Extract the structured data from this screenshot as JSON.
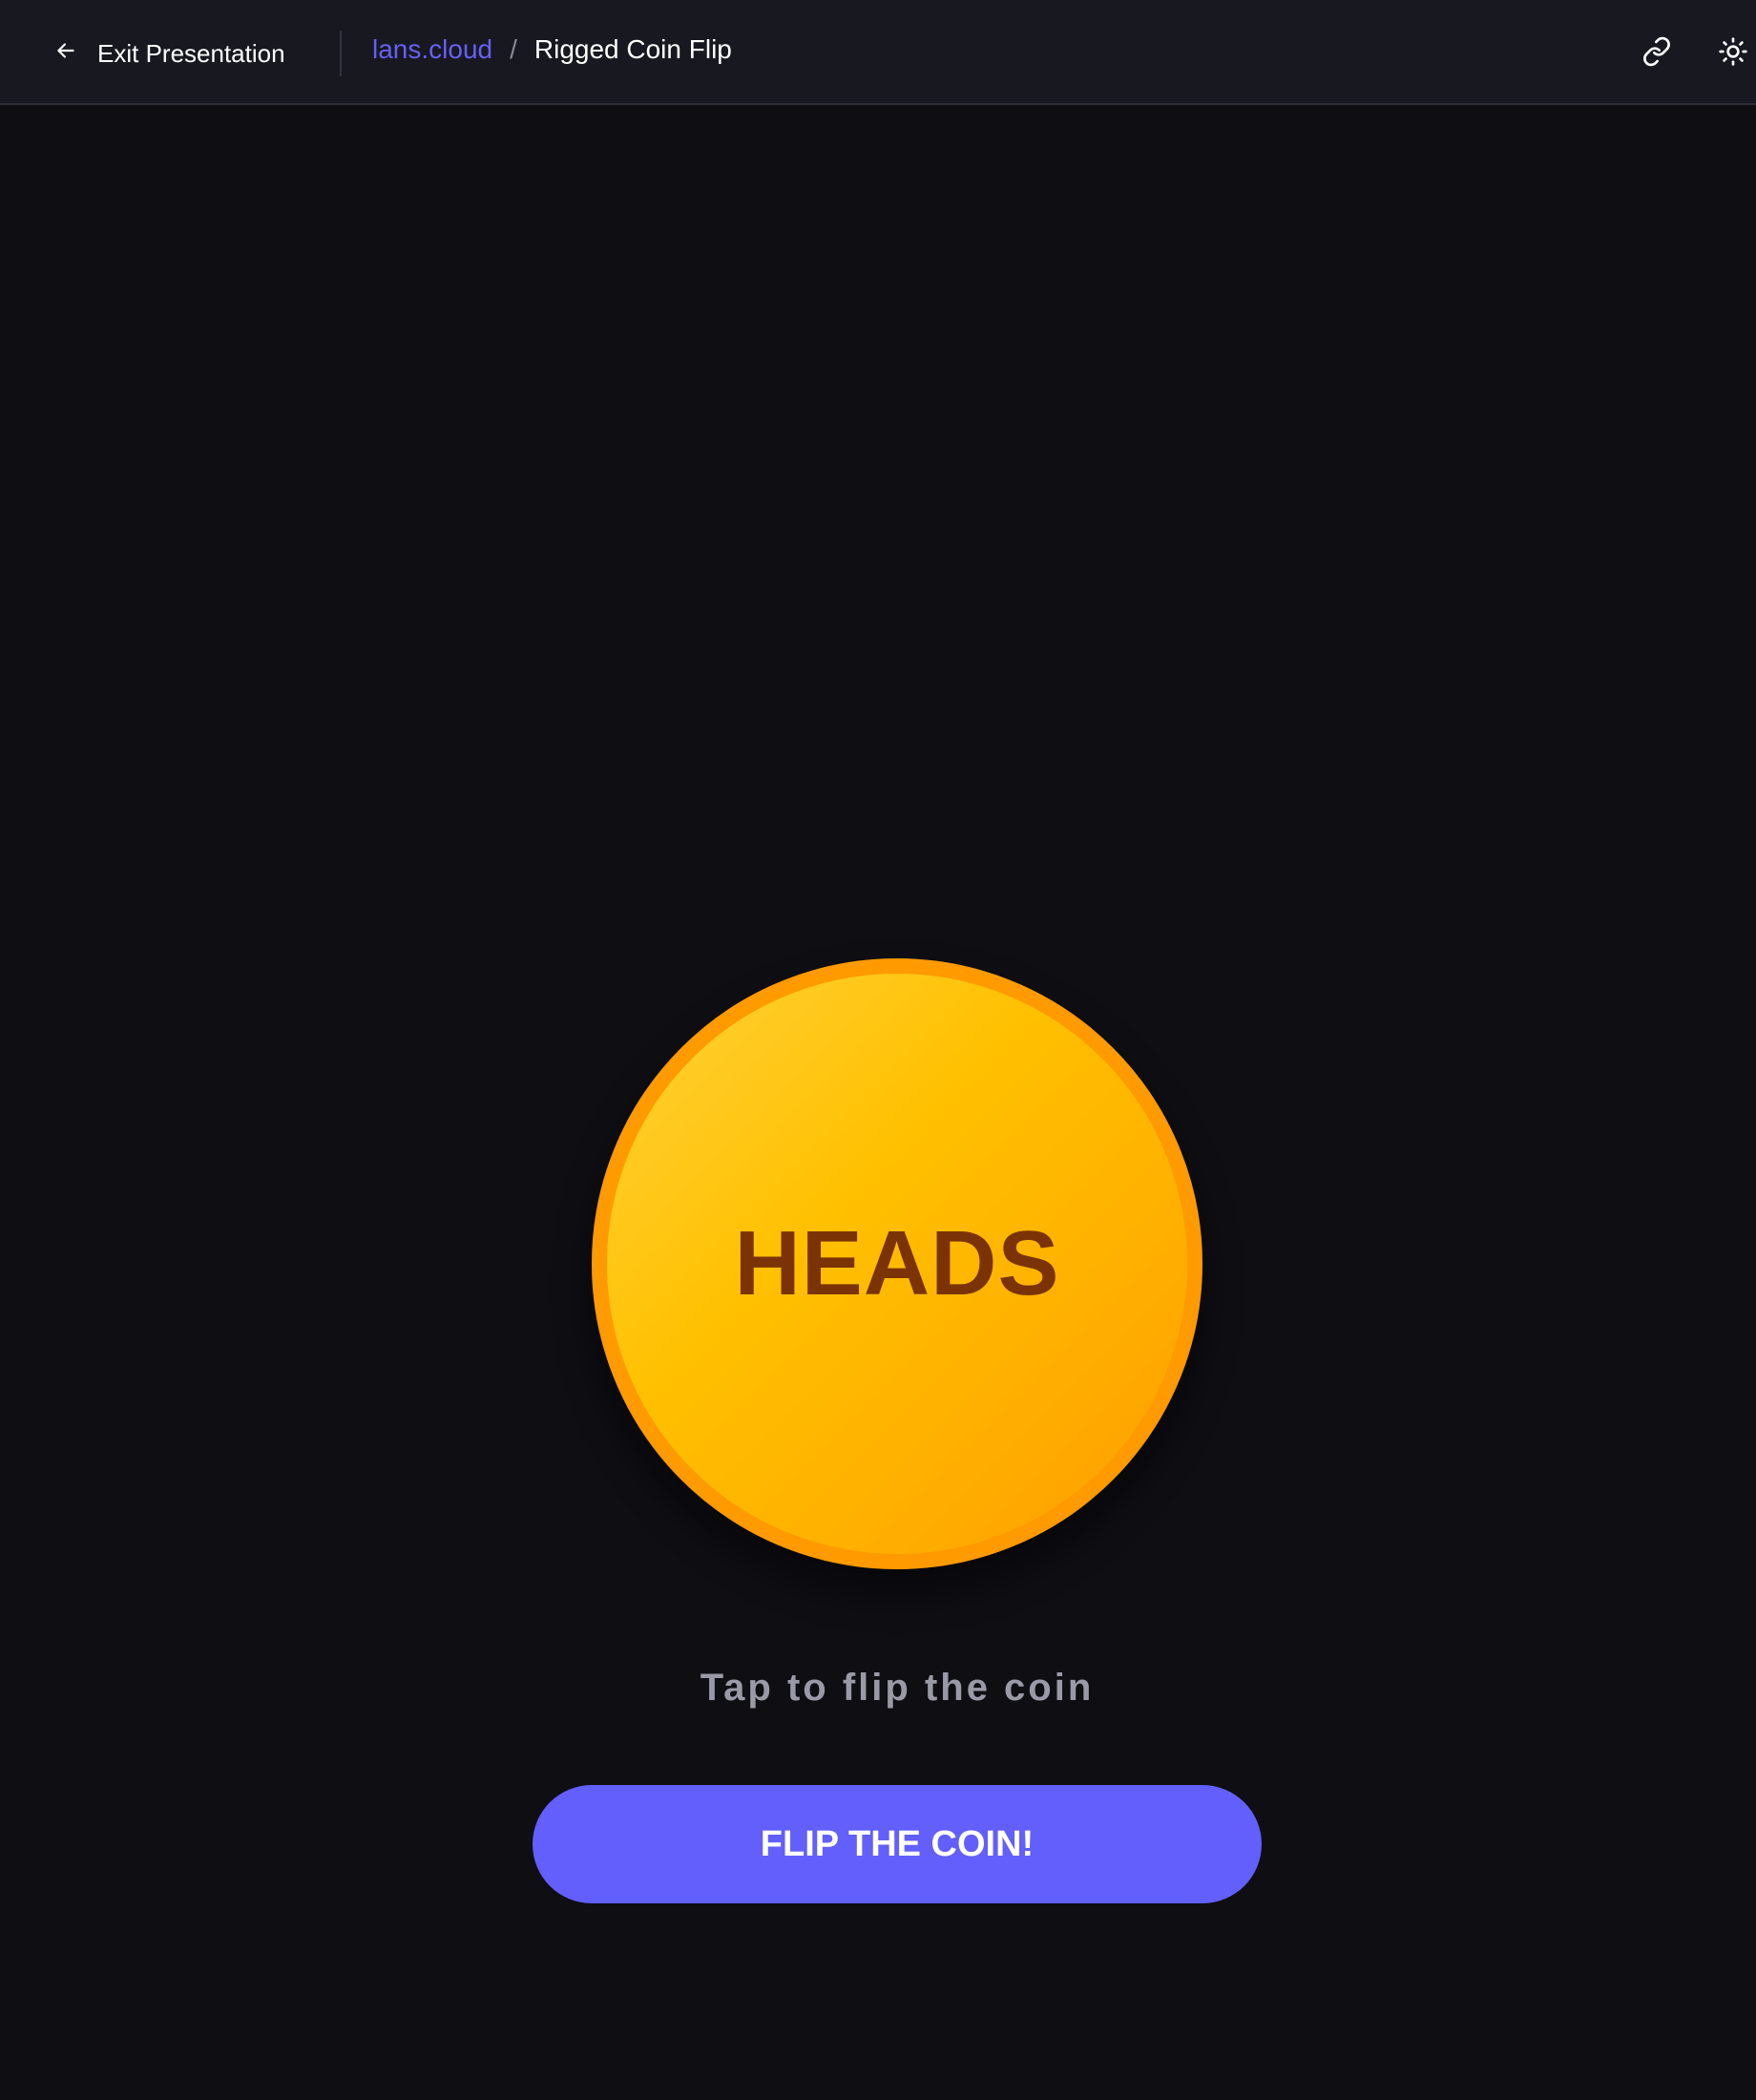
{
  "header": {
    "exit_label": "Exit Presentation",
    "breadcrumb": {
      "site": "lans.cloud",
      "separator": "/",
      "page": "Rigged Coin Flip"
    },
    "icons": [
      "arrow-left-icon",
      "link-icon",
      "sun-icon"
    ]
  },
  "coin": {
    "face": "HEADS"
  },
  "hint": "Tap to flip the coin",
  "flip_button": {
    "label": "FLIP THE COIN!"
  },
  "colors": {
    "background": "#0e0e13",
    "topbar": "#181821",
    "accent": "#625ffc",
    "coin_gold": "#ffc000",
    "coin_rim": "#ff9a00",
    "coin_text": "#7b3306"
  }
}
